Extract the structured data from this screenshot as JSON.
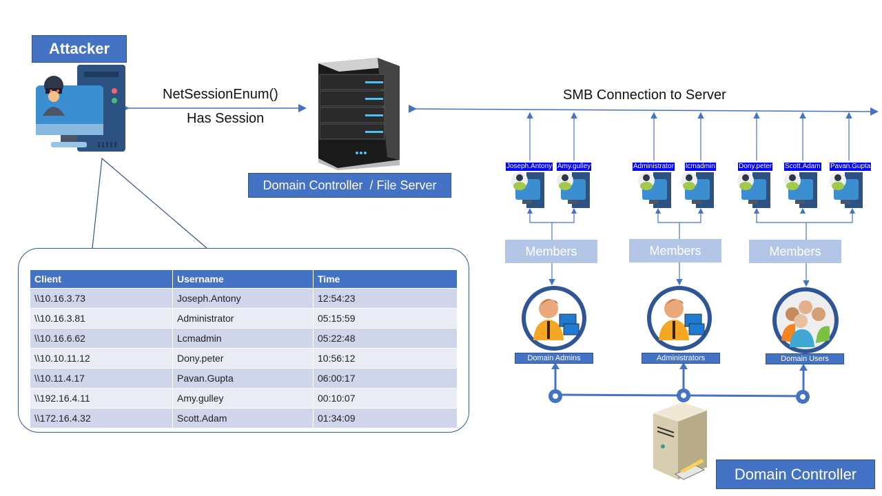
{
  "attacker": {
    "label": "Attacker",
    "icon": "hacker-computer-icon"
  },
  "connection_labels": {
    "call": "NetSessionEnum()",
    "response": "Has Session"
  },
  "file_server": {
    "label": "Domain Controller  / File Server",
    "icon": "server-rack-icon"
  },
  "smb": {
    "label": "SMB Connection to Server"
  },
  "user_hosts": [
    {
      "name": "Joseph.Antony"
    },
    {
      "name": "Amy.gulley"
    },
    {
      "name": "Administrator"
    },
    {
      "name": "lcmadmin"
    },
    {
      "name": "Dony.peter"
    },
    {
      "name": "Scott.Adam"
    },
    {
      "name": "Pavan.Gupta"
    }
  ],
  "members_label": "Members",
  "groups": [
    {
      "name": "Domain Admins",
      "icon": "admin-user-icon"
    },
    {
      "name": "Administrators",
      "icon": "admin-user-icon"
    },
    {
      "name": "Domain Users",
      "icon": "users-group-icon"
    }
  ],
  "domain_controller": {
    "label": "Domain Controller",
    "icon": "tower-server-icon"
  },
  "colors": {
    "accent": "#4472c4",
    "line": "#4472c4",
    "tag": "#0000ff",
    "members": "#b4c6e7"
  },
  "session_table": {
    "columns": [
      "Client",
      "Username",
      "Time"
    ],
    "rows": [
      [
        "\\\\10.16.3.73",
        "Joseph.Antony",
        "12:54:23"
      ],
      [
        "\\\\10.16.3.81",
        "Administrator",
        "05:15:59"
      ],
      [
        "\\\\10.16.6.62",
        "Lcmadmin",
        "05:22:48"
      ],
      [
        "\\\\10.10.11.12",
        "Dony.peter",
        "10:56:12"
      ],
      [
        "\\\\10.11.4.17",
        "Pavan.Gupta",
        "06:00:17"
      ],
      [
        "\\\\192.16.4.11",
        "Amy.gulley",
        "00:10:07"
      ],
      [
        "\\\\172.16.4.32",
        "Scott.Adam",
        "01:34:09"
      ]
    ]
  }
}
